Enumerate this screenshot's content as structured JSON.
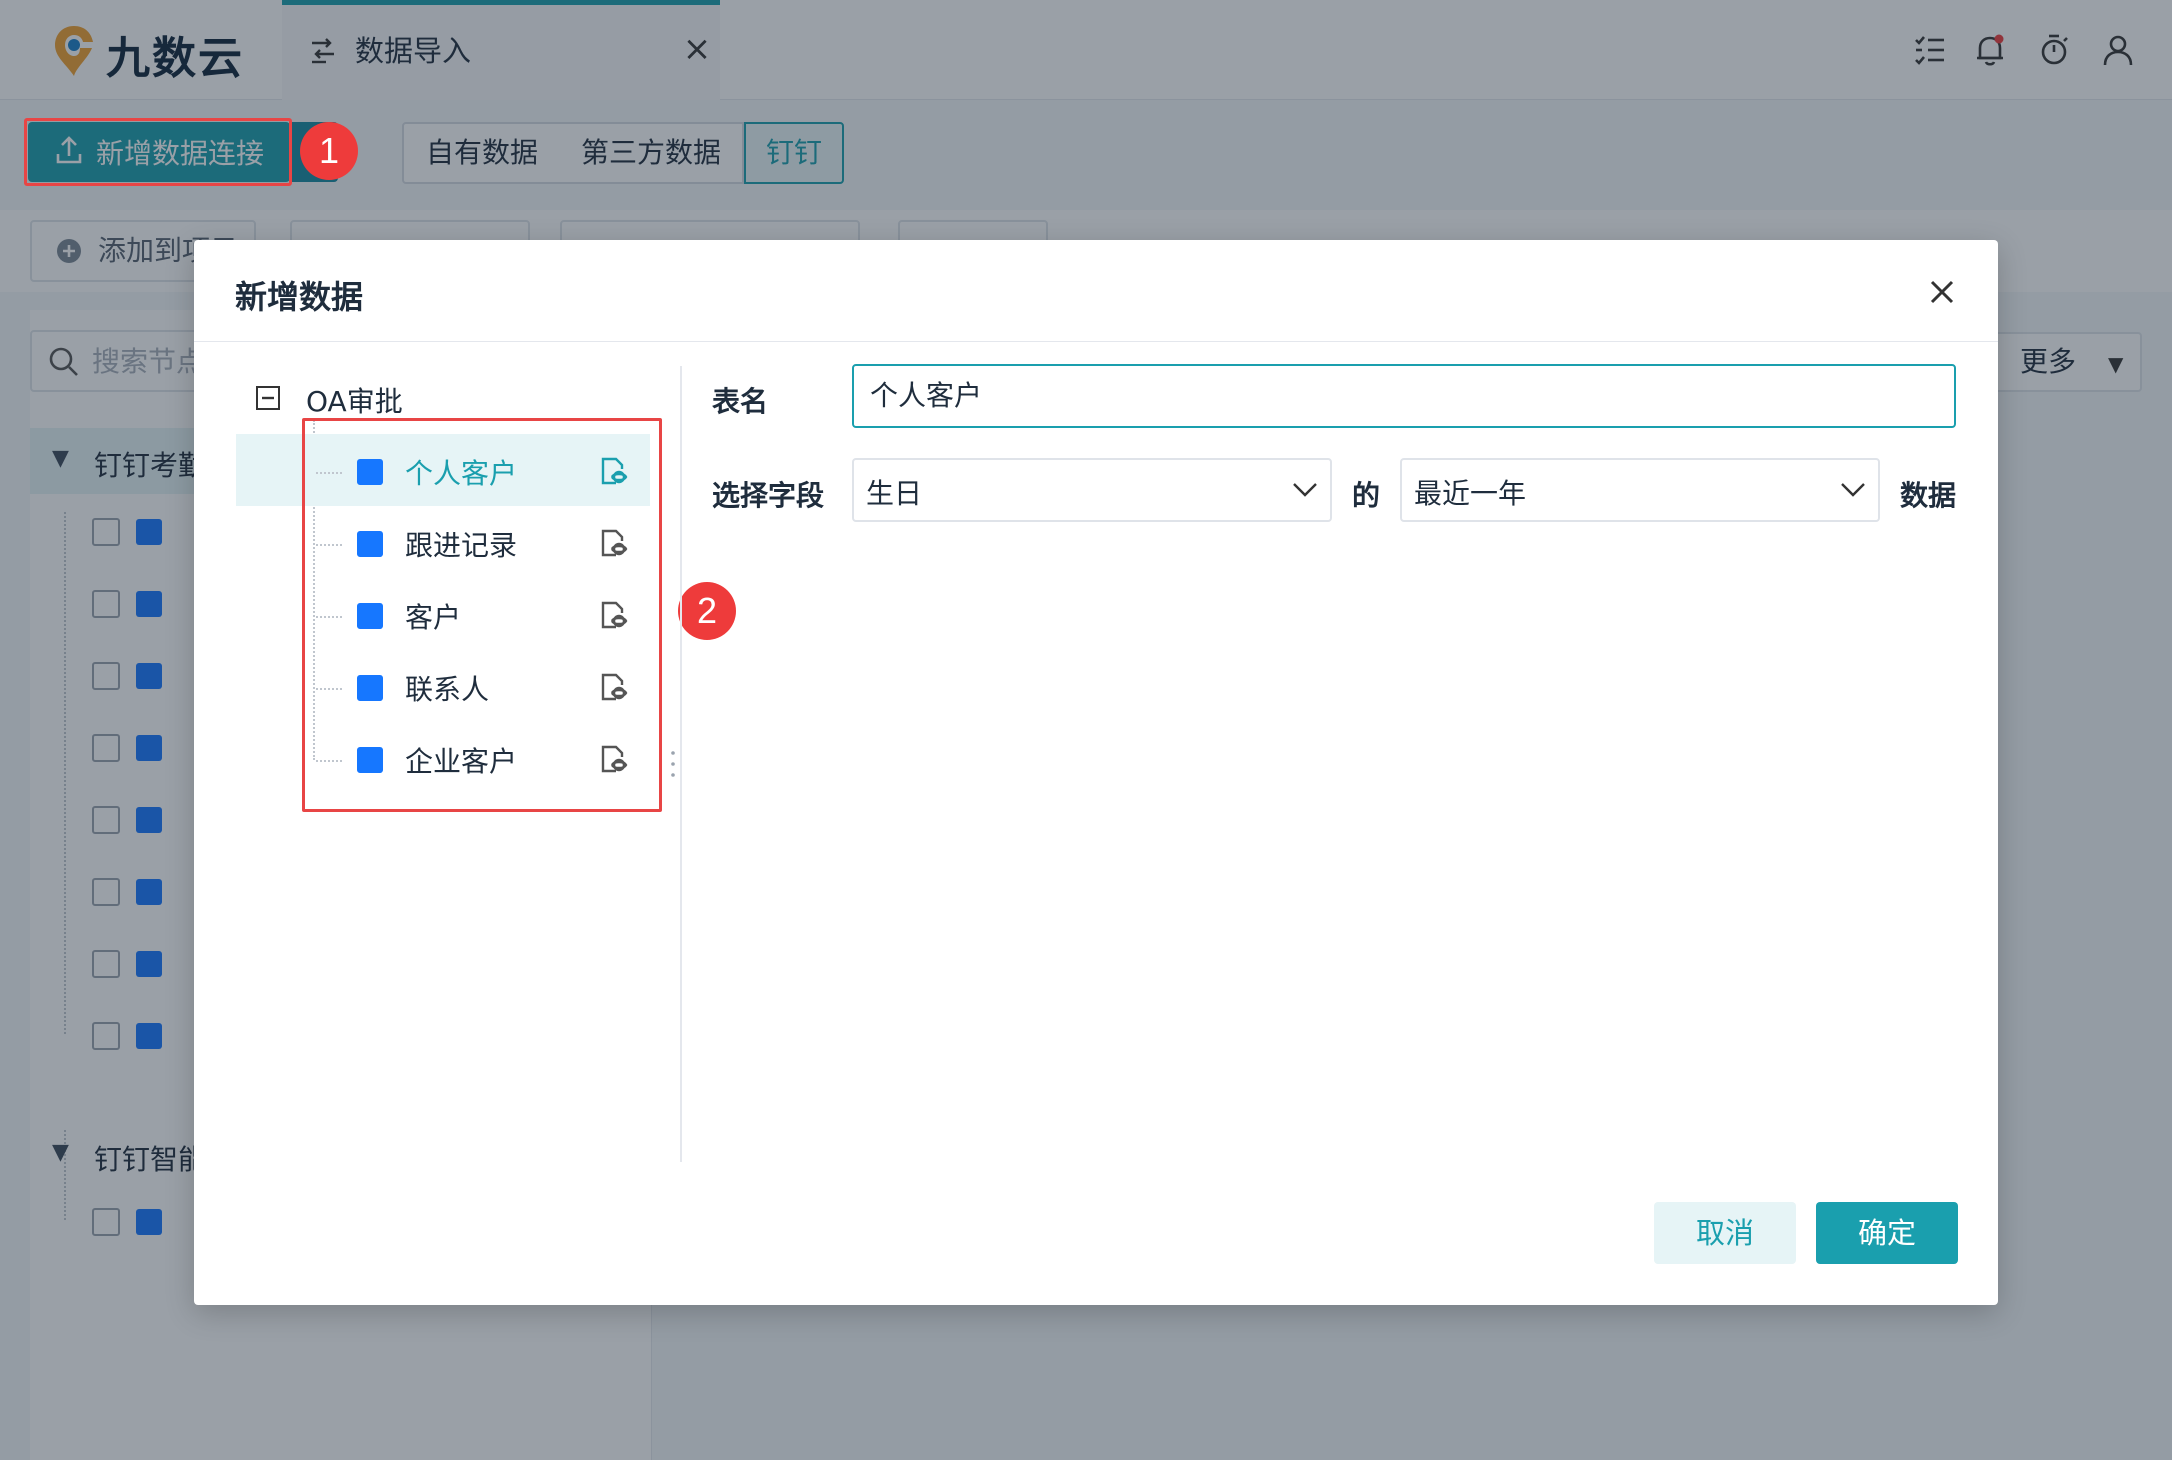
{
  "app": {
    "logo_text": "九数云"
  },
  "tabs": [
    {
      "label": "数据导入",
      "close": "×"
    }
  ],
  "header_icons": [
    "list-check-icon",
    "bell-icon",
    "timer-icon",
    "user-icon"
  ],
  "toolbar": {
    "new_connection_label": "新增数据连接",
    "segments": [
      "自有数据",
      "第三方数据",
      "钉钉"
    ],
    "active_segment": "钉钉",
    "add_to_project_label": "添加到项目",
    "more_label": "更多"
  },
  "sidebar": {
    "search_placeholder": "搜索节点",
    "groups": [
      {
        "label": "钉钉考勤",
        "items": 8
      },
      {
        "label": "钉钉智能",
        "items": 1
      }
    ]
  },
  "annotations": {
    "badge1": "1",
    "badge2": "2"
  },
  "modal": {
    "title": "新增数据",
    "tree": {
      "root_label": "OA审批",
      "items": [
        {
          "label": "个人客户",
          "selected": true
        },
        {
          "label": "跟进记录",
          "selected": false
        },
        {
          "label": "客户",
          "selected": false
        },
        {
          "label": "联系人",
          "selected": false
        },
        {
          "label": "企业客户",
          "selected": false
        }
      ]
    },
    "form": {
      "table_name_label": "表名",
      "table_name_value": "个人客户",
      "field_label": "选择字段",
      "field_value": "生日",
      "of_label": "的",
      "range_value": "最近一年",
      "data_label": "数据"
    },
    "cancel_label": "取消",
    "confirm_label": "确定"
  },
  "colors": {
    "accent": "#1a9fae",
    "highlight": "#e84545",
    "node_icon": "#1677ff"
  }
}
